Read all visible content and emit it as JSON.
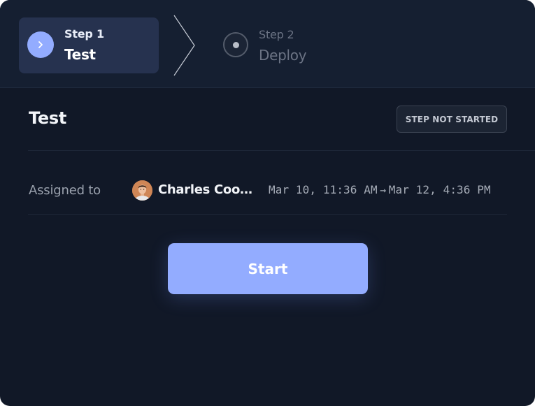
{
  "stepper": {
    "steps": [
      {
        "number": "Step 1",
        "name": "Test",
        "state": "active",
        "icon": "chevron-right-icon"
      },
      {
        "number": "Step 2",
        "name": "Deploy",
        "state": "inactive",
        "icon": "dot-icon"
      }
    ]
  },
  "task": {
    "title": "Test",
    "status": "STEP NOT STARTED",
    "assigned_label": "Assigned to",
    "assignee": "Charles Coo…",
    "start_date": "Mar 10, 11:36 AM",
    "end_date": "Mar 12, 4:36 PM",
    "action_label": "Start"
  },
  "colors": {
    "accent": "#93acff",
    "background": "#111827",
    "header": "#151f31",
    "active_step": "#26324f"
  }
}
